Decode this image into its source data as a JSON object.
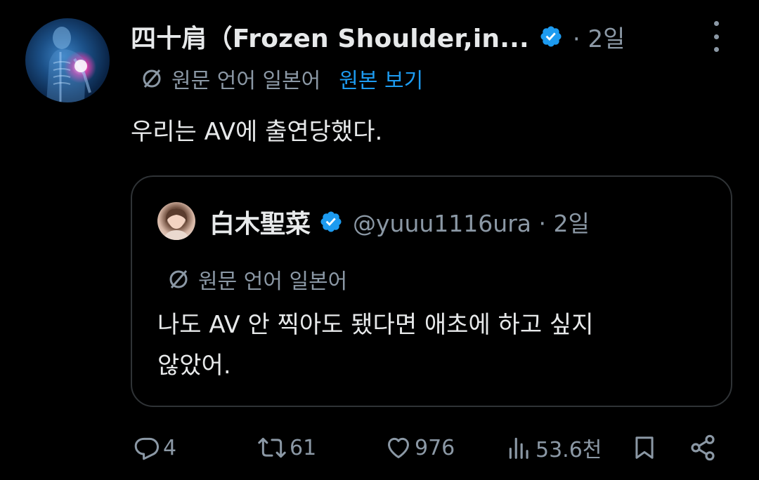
{
  "post": {
    "author_name": "四十肩（Frozen Shoulder,in...",
    "time": "· 2일",
    "translation_label": "원문 언어 일본어",
    "show_original": "원본 보기",
    "text": "우리는 AV에 출연당했다."
  },
  "quote": {
    "author_name": "白木聖菜",
    "handle_time": "@yuuu1116ura · 2일",
    "translation_label": "원문 언어 일본어",
    "text_line1": "나도 AV 안 찍아도 됐다면 애초에 하고 싶지",
    "text_line2": "않았어."
  },
  "actions": {
    "replies": "4",
    "reposts": "61",
    "likes": "976",
    "views": "53.6천"
  },
  "colors": {
    "background": "#000000",
    "text": "#e7e9ea",
    "secondary": "#8b98a5",
    "accent": "#1d9bf0",
    "border": "#2f3336"
  },
  "icons": [
    "verified-badge-icon",
    "translate-icon",
    "more-icon",
    "reply-icon",
    "repost-icon",
    "like-icon",
    "views-icon",
    "bookmark-icon",
    "share-icon"
  ]
}
